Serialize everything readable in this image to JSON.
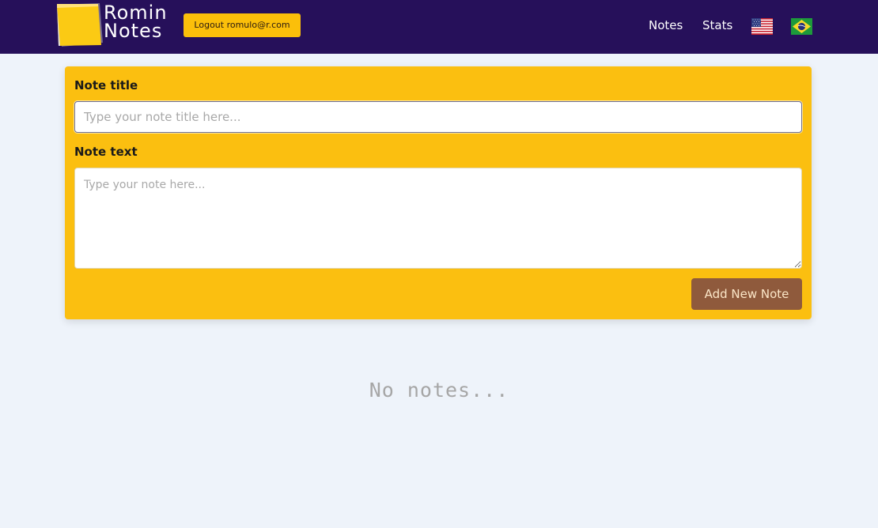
{
  "app": {
    "logo_line1": "Romin",
    "logo_line2": "Notes",
    "logout_label": "Logout romulo@r.com"
  },
  "nav": {
    "notes_label": "Notes",
    "stats_label": "Stats",
    "languages": [
      "us-flag-icon",
      "brazil-flag-icon"
    ]
  },
  "form": {
    "title_label": "Note title",
    "title_placeholder": "Type your note title here...",
    "title_value": "",
    "text_label": "Note text",
    "text_placeholder": "Type your note here...",
    "text_value": "",
    "submit_label": "Add New Note"
  },
  "notes": {
    "empty_message": "No notes..."
  },
  "colors": {
    "navbar": "#26105a",
    "accent": "#fbbf10",
    "submit_button": "#8f5a3c",
    "page_background": "#eef3fa"
  }
}
